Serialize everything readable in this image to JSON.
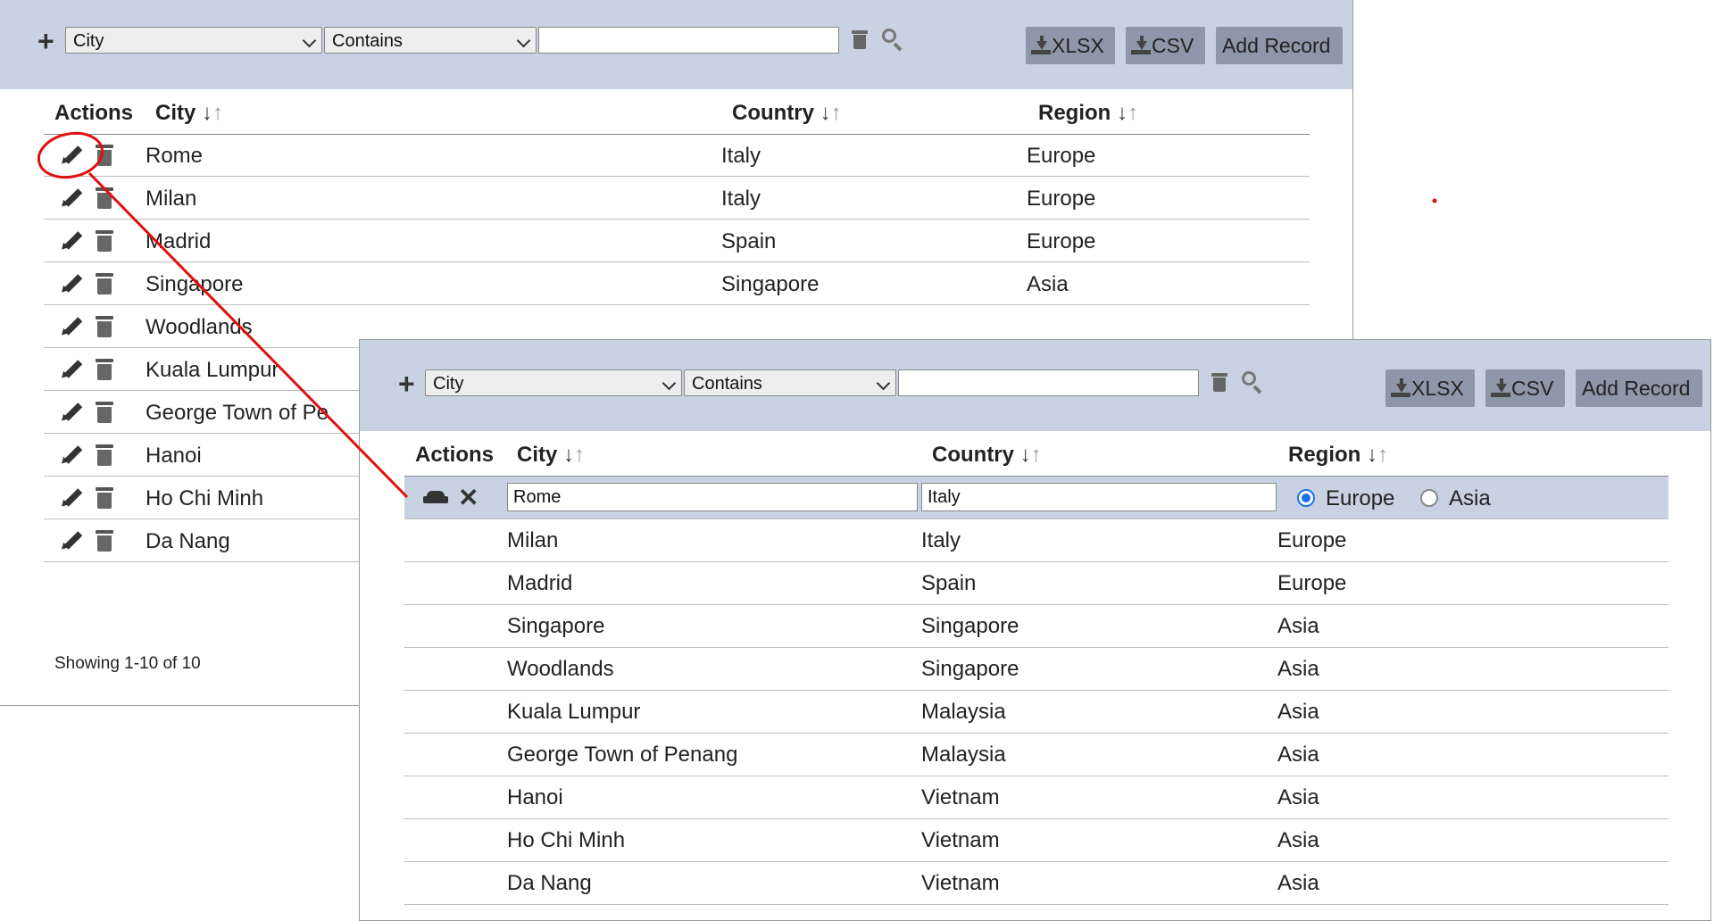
{
  "grid_back": {
    "toolbar": {
      "add_icon": "plus-icon",
      "field_select": "City",
      "operator_select": "Contains",
      "filter_value": "",
      "xlsx_label": "XLSX",
      "csv_label": "CSV",
      "add_record_label": "Add Record"
    },
    "headers": {
      "actions": "Actions",
      "city": "City",
      "country": "Country",
      "region": "Region"
    },
    "rows": [
      {
        "city": "Rome",
        "country": "Italy",
        "region": "Europe"
      },
      {
        "city": "Milan",
        "country": "Italy",
        "region": "Europe"
      },
      {
        "city": "Madrid",
        "country": "Spain",
        "region": "Europe"
      },
      {
        "city": "Singapore",
        "country": "Singapore",
        "region": "Asia"
      },
      {
        "city": "Woodlands",
        "country": "",
        "region": ""
      },
      {
        "city": "Kuala Lumpur",
        "country": "",
        "region": ""
      },
      {
        "city": "George Town of Pe",
        "country": "",
        "region": ""
      },
      {
        "city": "Hanoi",
        "country": "",
        "region": ""
      },
      {
        "city": "Ho Chi Minh",
        "country": "",
        "region": ""
      },
      {
        "city": "Da Nang",
        "country": "",
        "region": ""
      }
    ],
    "status": "Showing 1-10 of 10"
  },
  "grid_front": {
    "toolbar": {
      "field_select": "City",
      "operator_select": "Contains",
      "filter_value": "",
      "xlsx_label": "XLSX",
      "csv_label": "CSV",
      "add_record_label": "Add Record"
    },
    "headers": {
      "actions": "Actions",
      "city": "City",
      "country": "Country",
      "region": "Region"
    },
    "edit_row": {
      "city": "Rome",
      "country": "Italy",
      "region_options": [
        "Europe",
        "Asia"
      ],
      "region_selected": "Europe"
    },
    "rows": [
      {
        "city": "Milan",
        "country": "Italy",
        "region": "Europe"
      },
      {
        "city": "Madrid",
        "country": "Spain",
        "region": "Europe"
      },
      {
        "city": "Singapore",
        "country": "Singapore",
        "region": "Asia"
      },
      {
        "city": "Woodlands",
        "country": "Singapore",
        "region": "Asia"
      },
      {
        "city": "Kuala Lumpur",
        "country": "Malaysia",
        "region": "Asia"
      },
      {
        "city": "George Town of Penang",
        "country": "Malaysia",
        "region": "Asia"
      },
      {
        "city": "Hanoi",
        "country": "Vietnam",
        "region": "Asia"
      },
      {
        "city": "Ho Chi Minh",
        "country": "Vietnam",
        "region": "Asia"
      },
      {
        "city": "Da Nang",
        "country": "Vietnam",
        "region": "Asia"
      }
    ]
  },
  "colors": {
    "toolbar_bg": "#c9d2e2",
    "button_bg": "#8d97a9",
    "annotation": "#e01010",
    "radio_on": "#1a73e8"
  },
  "sort_glyph": "↓↑"
}
